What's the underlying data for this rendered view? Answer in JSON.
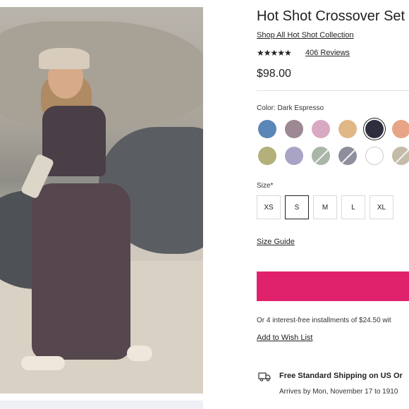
{
  "product": {
    "title": "Hot Shot Crossover Set",
    "collection_link": "Shop All Hot Shot Collection",
    "stars": "★★★★★",
    "rating": 4.5,
    "reviews": "406 Reviews",
    "price": "$98.00"
  },
  "colors": {
    "label": "Color: Dark Espresso",
    "swatches": [
      {
        "name": "blue-tie-dye",
        "color": "#5a86b8",
        "selected": false,
        "unavailable": false
      },
      {
        "name": "mauve",
        "color": "#9d8893",
        "selected": false,
        "unavailable": false
      },
      {
        "name": "pink-tie-dye",
        "color": "#d9a9c3",
        "selected": false,
        "unavailable": false
      },
      {
        "name": "tan",
        "color": "#e0b886",
        "selected": false,
        "unavailable": false
      },
      {
        "name": "dark-espresso",
        "color": "#2f2e3e",
        "selected": true,
        "unavailable": false
      },
      {
        "name": "peach",
        "color": "#e7a486",
        "selected": false,
        "unavailable": false
      },
      {
        "name": "olive",
        "color": "#b3b07a",
        "selected": false,
        "unavailable": false
      },
      {
        "name": "lavender",
        "color": "#a9a4c6",
        "selected": false,
        "unavailable": false
      },
      {
        "name": "sage",
        "color": "#a9b6a8",
        "selected": false,
        "unavailable": true
      },
      {
        "name": "slate",
        "color": "#8e8f9c",
        "selected": false,
        "unavailable": true
      },
      {
        "name": "white",
        "color": "#ffffff",
        "selected": false,
        "unavailable": false
      },
      {
        "name": "khaki",
        "color": "#c5bca8",
        "selected": false,
        "unavailable": true
      }
    ]
  },
  "sizes": {
    "label": "Size*",
    "options": [
      "XS",
      "S",
      "M",
      "L",
      "XL"
    ],
    "selected": "S"
  },
  "size_guide": "Size Guide",
  "add_to_bag_color": "#e0226c",
  "installments": "Or 4 interest-free installments of $24.50 wit",
  "wishlist": "Add to Wish List",
  "shipping": {
    "title": "Free Standard Shipping on US Or",
    "arrival": "Arrives by Mon, November 17 to 1910",
    "icon": "truck-icon"
  }
}
